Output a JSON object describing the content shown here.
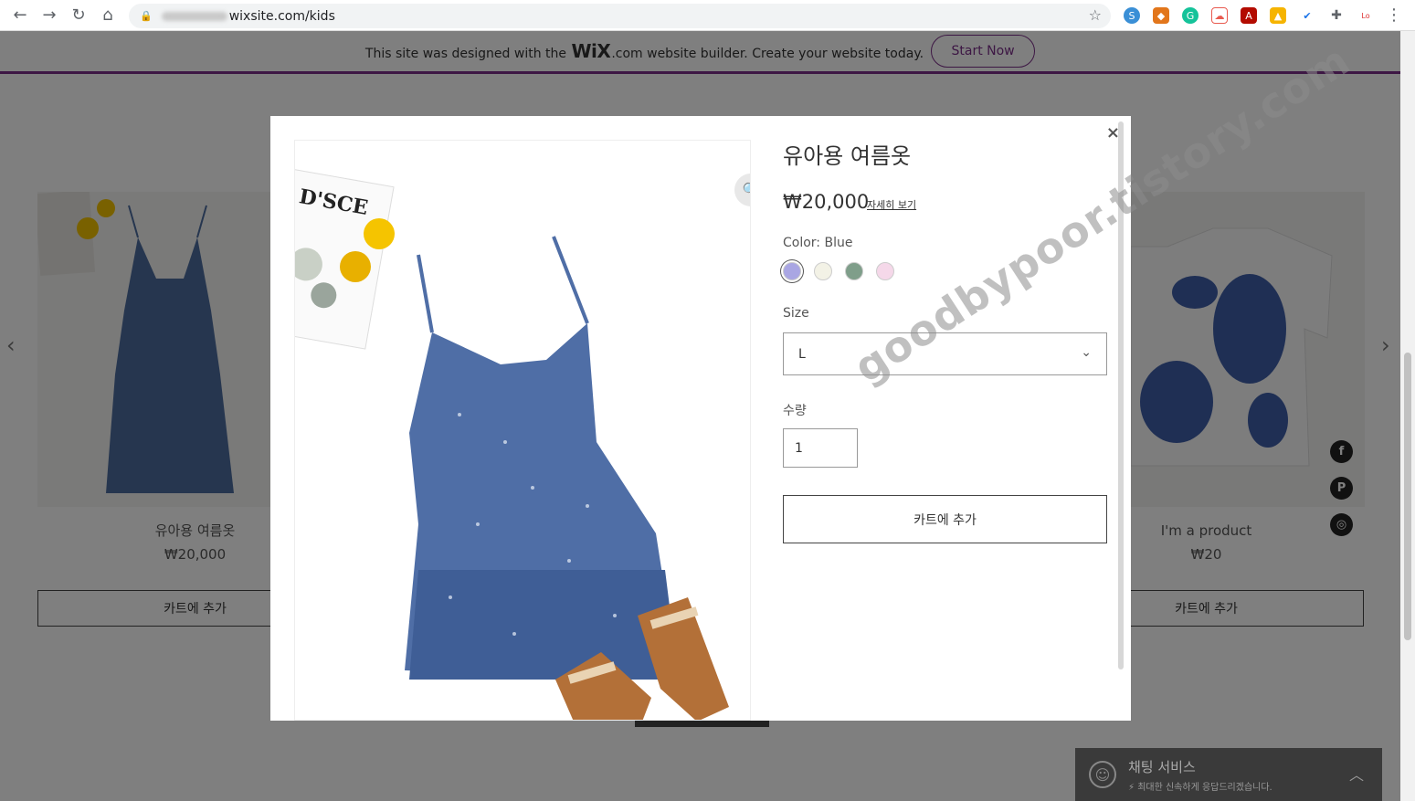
{
  "browser": {
    "url_domain": "wixsite.com/kids",
    "nav_icons": [
      "back-icon",
      "forward-icon",
      "reload-icon",
      "home-icon"
    ],
    "extensions": [
      "skype-icon",
      "metamask-icon",
      "grammarly-icon",
      "cloud-icon",
      "pdf-icon",
      "drive-icon",
      "check-icon",
      "puzzle-icon",
      "text-icon"
    ]
  },
  "wix_banner": {
    "text_before": "This site was designed with the",
    "logo": "WiX",
    "text_after": ".com website builder. Create your website today.",
    "button": "Start Now",
    "accent": "#7a2e88"
  },
  "products": [
    {
      "name": "유아용 여름옷",
      "price": "₩20,000",
      "button": "카트에 추가"
    },
    {
      "name": "I'm a product",
      "price": "₩20",
      "button": "카트에 추가"
    }
  ],
  "social": [
    "facebook-icon",
    "pinterest-icon",
    "instagram-icon"
  ],
  "chat": {
    "title": "채팅 서비스",
    "subtitle": "최대한 신속하게 응답드리겠습니다."
  },
  "modal": {
    "title": "유아용 여름옷",
    "price": "₩20,000",
    "details_link": "자세히 보기",
    "color_label": "Color: Blue",
    "colors": [
      "#a9a6e3",
      "#f3f2e6",
      "#7f9e8a",
      "#f5d8e9"
    ],
    "selected_color_index": 0,
    "size_label": "Size",
    "size_value": "L",
    "qty_label": "수량",
    "qty_value": "1",
    "add_button": "카트에 추가",
    "close": "×"
  },
  "watermark": "goodbypoor.tistory.com"
}
